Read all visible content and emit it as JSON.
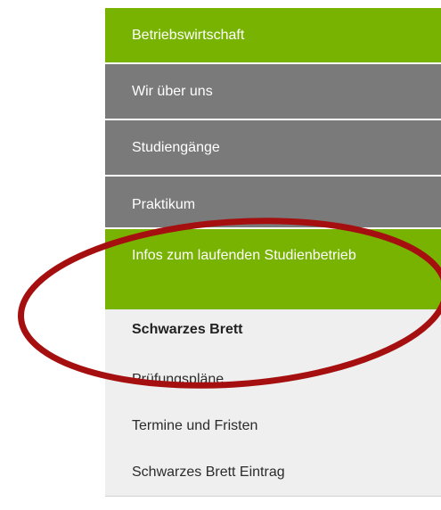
{
  "nav": {
    "items": [
      {
        "label": "Betriebswirtschaft"
      },
      {
        "label": "Wir über uns"
      },
      {
        "label": "Studiengänge"
      },
      {
        "label": "Praktikum"
      },
      {
        "label": "Infos zum laufenden Studienbetrieb"
      }
    ],
    "sub_items": [
      {
        "label": "Schwarzes Brett"
      },
      {
        "label": "Prüfungspläne"
      },
      {
        "label": "Termine und Fristen"
      },
      {
        "label": "Schwarzes Brett Eintrag"
      }
    ]
  },
  "colors": {
    "green": "#77b300",
    "gray": "#7a7a7a",
    "sub_bg": "#efefef",
    "annotation_ellipse": "#a50f0f"
  }
}
